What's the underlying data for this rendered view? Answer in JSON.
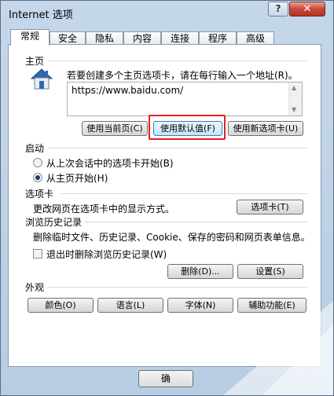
{
  "window": {
    "title": "Internet 选项",
    "help_label": "?",
    "close_label": "✕"
  },
  "tabs": [
    {
      "label": "常规",
      "active": true
    },
    {
      "label": "安全"
    },
    {
      "label": "隐私"
    },
    {
      "label": "内容"
    },
    {
      "label": "连接"
    },
    {
      "label": "程序"
    },
    {
      "label": "高级"
    }
  ],
  "homepage": {
    "heading": "主页",
    "description": "若要创建多个主页选项卡，请在每行输入一个地址(R)。",
    "url": "https://www.baidu.com/",
    "use_current_label": "使用当前页(C)",
    "use_default_label": "使用默认值(F)",
    "use_new_tab_label": "使用新选项卡(U)"
  },
  "startup": {
    "heading": "启动",
    "option_last_session": "从上次会话中的选项卡开始(B)",
    "option_homepage": "从主页开始(H)",
    "selected": "homepage"
  },
  "tabs_section": {
    "heading": "选项卡",
    "description": "更改网页在选项卡中的显示方式。",
    "button_label": "选项卡(T)"
  },
  "history": {
    "heading": "浏览历史记录",
    "description": "删除临时文件、历史记录、Cookie、保存的密码和网页表单信息。",
    "checkbox_label": "退出时删除浏览历史记录(W)",
    "checkbox_checked": false,
    "delete_label": "删除(D)...",
    "settings_label": "设置(S)"
  },
  "appearance": {
    "heading": "外观",
    "colors_label": "颜色(O)",
    "languages_label": "语言(L)",
    "fonts_label": "字体(N)",
    "accessibility_label": "辅助功能(E)"
  },
  "footer": {
    "ok_label": "确"
  }
}
